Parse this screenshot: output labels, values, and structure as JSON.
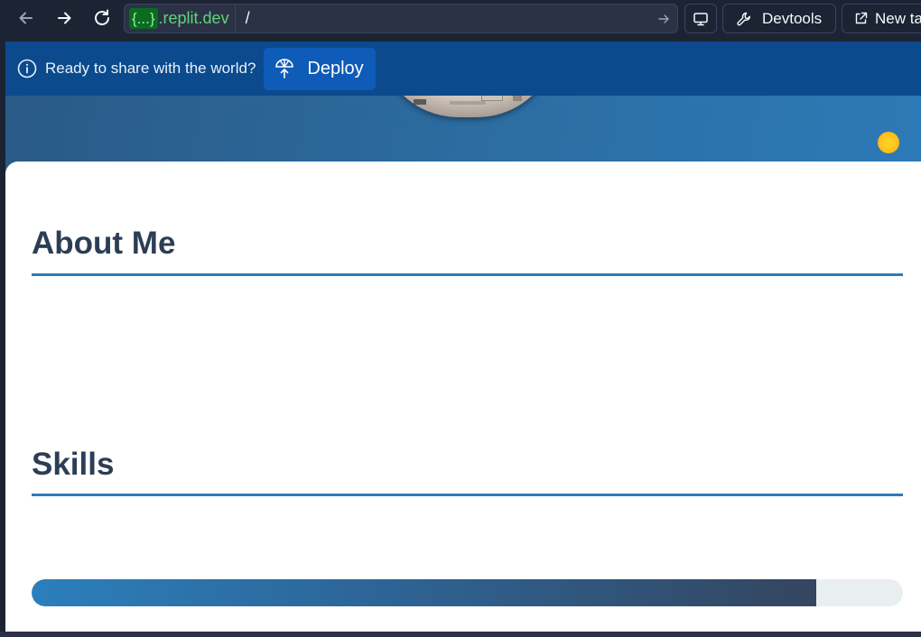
{
  "browser": {
    "url_badge": "{...}",
    "url_domain": ".replit.dev",
    "url_path": "/",
    "devtools_label": "Devtools",
    "new_tab_label": "New tab",
    "icons": [
      "back-arrow-icon",
      "forward-arrow-icon",
      "reload-icon",
      "go-arrow-icon",
      "monitor-icon",
      "wrench-icon",
      "external-link-icon"
    ]
  },
  "banner": {
    "message": "Ready to share with the world?",
    "deploy_label": "Deploy",
    "icons": [
      "info-icon",
      "deploy-icon"
    ]
  },
  "page": {
    "theme_icon": "sun-icon",
    "sections": {
      "about_title": "About Me",
      "skills_title": "Skills"
    },
    "skills": [
      {
        "level": 0.9
      }
    ]
  },
  "colors": {
    "accent": "#2f7ab7",
    "heading": "#2c3e55",
    "banner": "#0b4a8c",
    "deploy_button": "#0e5bb8"
  }
}
